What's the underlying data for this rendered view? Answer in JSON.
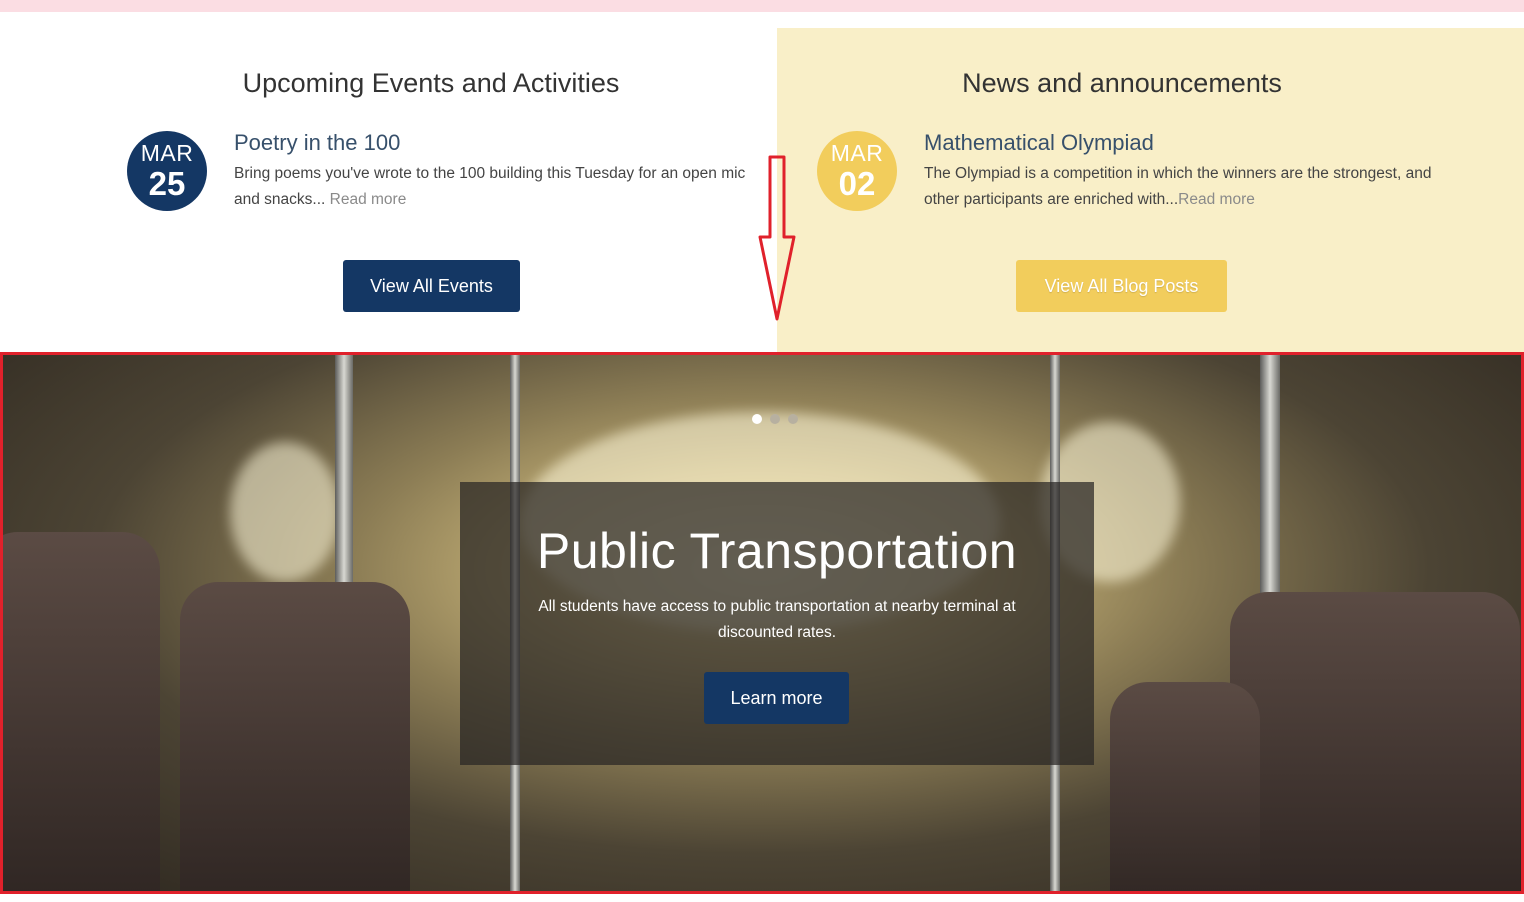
{
  "events": {
    "heading": "Upcoming Events and Activities",
    "item": {
      "month": "MAR",
      "day": "25",
      "title": "Poetry in the 100",
      "description": "Bring poems you've wrote to the 100 building this Tuesday for an open mic and snacks...",
      "read_more": "Read more"
    },
    "button_label": "View All Events"
  },
  "news": {
    "heading": "News and announcements",
    "item": {
      "month": "MAR",
      "day": "02",
      "title": "Mathematical Olympiad",
      "description": "The Olympiad is a competition in which the winners are the strongest, and other participants are enriched with...",
      "read_more": "Read more"
    },
    "button_label": "View All Blog Posts"
  },
  "slider": {
    "active_slide": 1,
    "slide_count": 3,
    "title": "Public Transportation",
    "text": "All students have access to public transportation at nearby terminal at discounted rates.",
    "button_label": "Learn more"
  },
  "colors": {
    "navy": "#143764",
    "gold": "#f2cd5c",
    "cream": "#f9efc8",
    "annotation_red": "#e0212b"
  }
}
